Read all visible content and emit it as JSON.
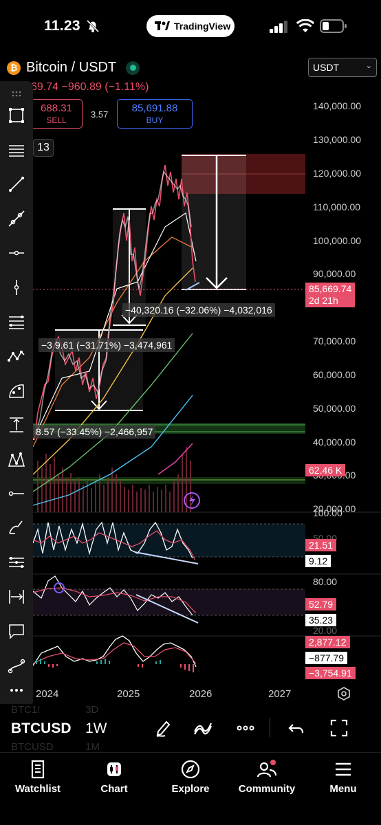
{
  "status_bar": {
    "time": "11.23",
    "app_pill": "TradingView"
  },
  "header": {
    "symbol_title": "Bitcoin / USDT",
    "currency": "USDT",
    "price_partial": "69.74",
    "change": "−960.89",
    "change_pct": "(−1.11%)",
    "sell_price": "688.31",
    "sell_label": "SELL",
    "spread": "3.57",
    "buy_price": "85,691.88",
    "buy_label": "BUY",
    "indicator_count": "13"
  },
  "price_axis": {
    "ticks": [
      "140,000.00",
      "130,000.00",
      "120,000.00",
      "110,000.00",
      "100,000.00",
      "90,000.00",
      "70,000.00",
      "60,000.00",
      "50,000.00",
      "40,000.00",
      "30,000.00",
      "20,000.00"
    ],
    "current_price": "85,669.74",
    "countdown": "2d 21h",
    "volume": "62.46 K"
  },
  "measurements": {
    "drop_2025": "−40,320.16 (−32.06%) −4,032,016",
    "drop_2024_a": "−3",
    "drop_2024_b": "9.61 (−31.71%) −3,474,961",
    "drop_2024_c": "8.57 (−33.45%) −2,466,957"
  },
  "oscillators": {
    "rsi_top": "100.00",
    "rsi_mid": "50.00",
    "rsi_value": "21.51",
    "rsi_value2": "9.12",
    "osc2_top": "80.00",
    "osc2_value": "52.79",
    "osc2_value2": "35.23",
    "osc2_bottom": "20.00",
    "macd_value": "2,877.12",
    "macd_signal": "−877.79",
    "macd_hist": "−3,754.91"
  },
  "time_axis": [
    "2024",
    "2025",
    "2026",
    "2027"
  ],
  "symbol_bar": {
    "ticker": "BTCUSD",
    "interval": "1W",
    "ghost_1_ticker": "BTC1!",
    "ghost_1_interval": "3D",
    "ghost_2_ticker": "BTCUSD",
    "ghost_2_interval": "1M"
  },
  "nav": {
    "items": [
      {
        "label": "Watchlist",
        "icon": "book-icon"
      },
      {
        "label": "Chart",
        "icon": "candles-icon"
      },
      {
        "label": "Explore",
        "icon": "compass-icon"
      },
      {
        "label": "Community",
        "icon": "people-icon"
      },
      {
        "label": "Menu",
        "icon": "hamburger-icon"
      }
    ]
  },
  "colors": {
    "accent_red": "#e84f6b",
    "accent_blue": "#3d6bff",
    "background": "#000000"
  }
}
